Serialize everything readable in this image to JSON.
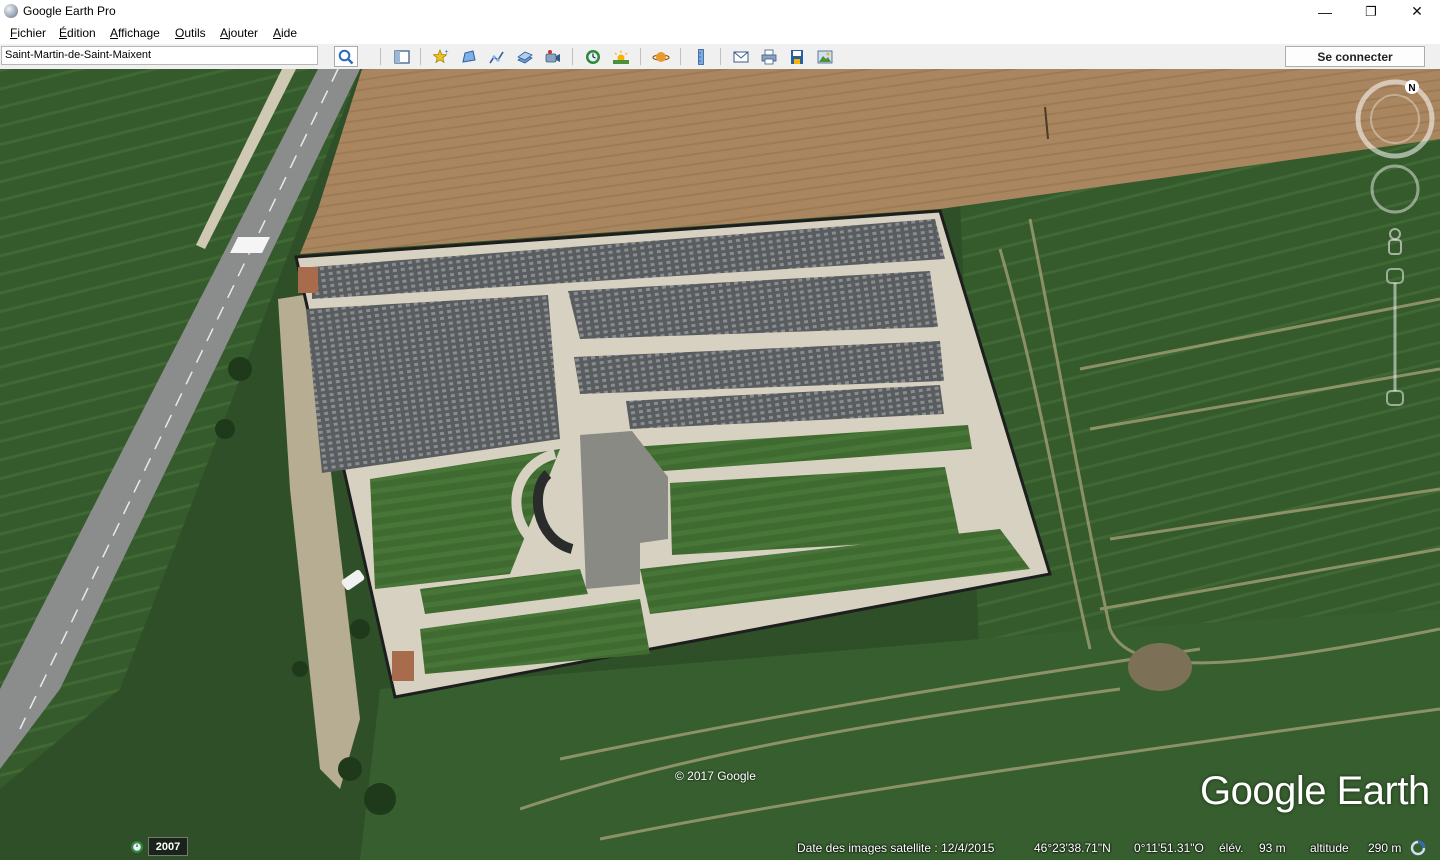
{
  "window": {
    "title": "Google Earth Pro",
    "minimize": "—",
    "restore": "❐",
    "close": "✕"
  },
  "menu": {
    "items": [
      "Fichier",
      "Édition",
      "Affichage",
      "Outils",
      "Ajouter",
      "Aide"
    ]
  },
  "toolbar": {
    "search_value": "Saint-Martin-de-Saint-Maixent",
    "signin_label": "Se connecter",
    "icons": [
      "search-icon",
      "sidebar-toggle-icon",
      "add-placemark-icon",
      "add-polygon-icon",
      "add-path-icon",
      "add-image-overlay-icon",
      "record-tour-icon",
      "historical-imagery-icon",
      "sunlight-icon",
      "switch-planet-icon",
      "ruler-icon",
      "email-icon",
      "print-icon",
      "save-image-icon",
      "view-in-maps-icon"
    ]
  },
  "map": {
    "copyright": "© 2017 Google",
    "logo": "Google Earth",
    "compass_north": "N"
  },
  "status": {
    "historical_year": "2007",
    "imagery_date": "Date des images satellite : 12/4/2015",
    "latitude": "46°23'38.71\"N",
    "longitude": "0°11'51.31\"O",
    "elevation_label": "élév.",
    "elevation_value": "93 m",
    "altitude_label": "altitude",
    "altitude_value": "290 m"
  },
  "colors": {
    "field_dark": "#2f4f28",
    "field_brown": "#a8845d",
    "road": "#8a8c8a",
    "cemetery_gray": "#55585a",
    "accent_blue": "#2a6cc2"
  }
}
